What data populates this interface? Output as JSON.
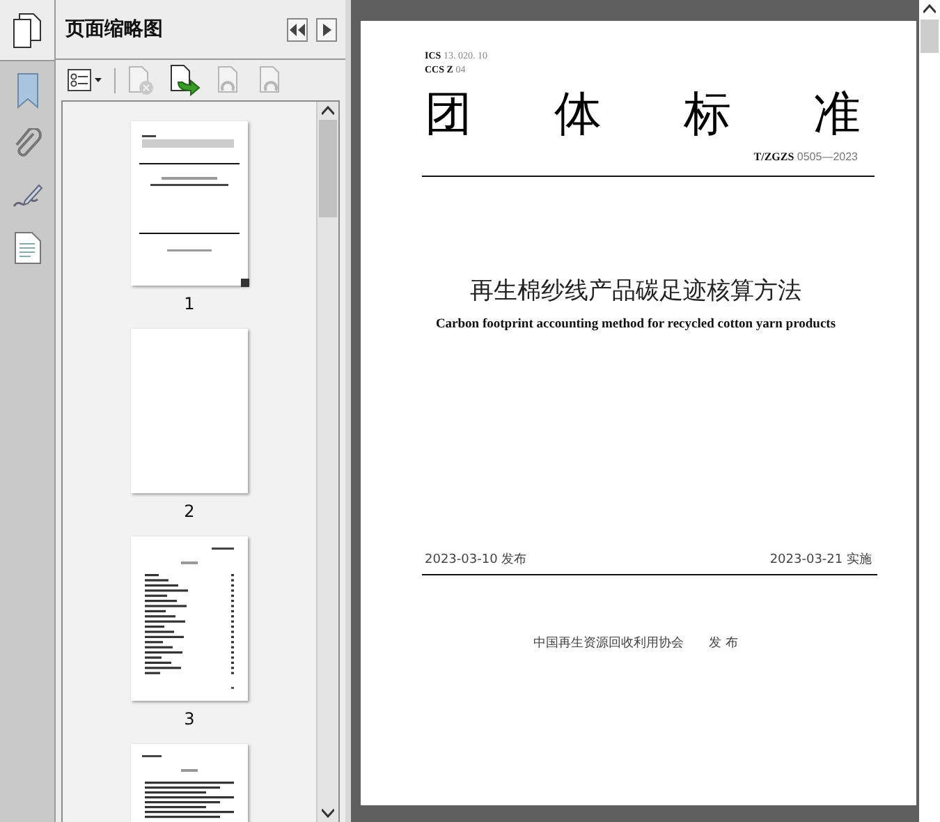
{
  "rail": [
    {
      "kind": "pages"
    },
    {
      "kind": "bookmark"
    },
    {
      "kind": "paperclip"
    },
    {
      "kind": "signature"
    },
    {
      "kind": "document"
    }
  ],
  "panel": {
    "title": "页面缩略图"
  },
  "toolbar": [
    {
      "kind": "options",
      "disabled": false
    },
    {
      "kind": "delete",
      "disabled": true
    },
    {
      "kind": "insert",
      "disabled": false
    },
    {
      "kind": "undo",
      "disabled": true
    },
    {
      "kind": "redo",
      "disabled": true
    }
  ],
  "thumbnails": [
    {
      "label": "1",
      "kind": "cover",
      "current": true
    },
    {
      "label": "2",
      "kind": "blank",
      "current": false
    },
    {
      "label": "3",
      "kind": "contents",
      "current": false
    },
    {
      "kind": "text"
    }
  ],
  "document": {
    "ics": "**ICS** 13. 020. 10",
    "ccs": "**CCS Z** 04",
    "heading": [
      "团",
      "体",
      "标",
      "准"
    ],
    "code": "**T/ZGZS** 0505—2023",
    "title_zh": "再生棉纱线产品碳足迹核算方法",
    "title_en": "Carbon footprint accounting method for recycled cotton yarn products",
    "publish_date": "2023-03-10 发布",
    "effective_date": "2023-03-21 实施",
    "publisher": "中国再生资源回收利用协会",
    "publisher_action": "发 布"
  }
}
